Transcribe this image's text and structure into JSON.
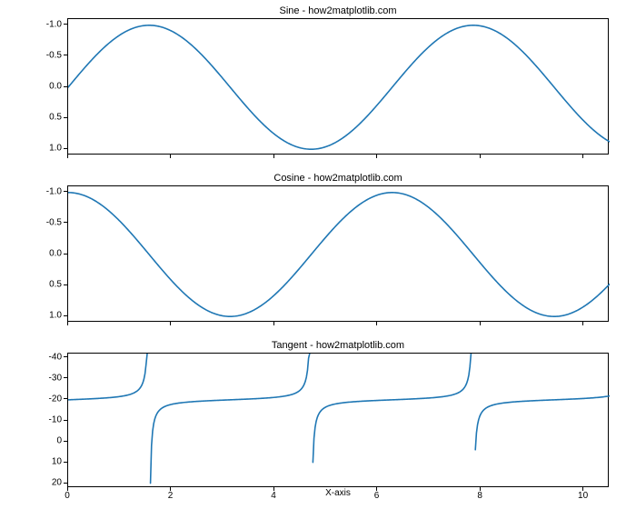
{
  "chart_data": [
    {
      "type": "line",
      "title": "Sine - how2matplotlib.com",
      "xlabel": "",
      "ylabel": "",
      "xlim": [
        0,
        10.5
      ],
      "ylim": [
        -1.1,
        1.1
      ],
      "xticks": [
        0,
        2,
        4,
        6,
        8,
        10
      ],
      "yticks": [
        -1.0,
        -0.5,
        0.0,
        0.5,
        1.0
      ],
      "function": "sin"
    },
    {
      "type": "line",
      "title": "Cosine - how2matplotlib.com",
      "xlabel": "",
      "ylabel": "",
      "xlim": [
        0,
        10.5
      ],
      "ylim": [
        -1.1,
        1.1
      ],
      "xticks": [
        0,
        2,
        4,
        6,
        8,
        10
      ],
      "yticks": [
        -1.0,
        -0.5,
        0.0,
        0.5,
        1.0
      ],
      "function": "cos"
    },
    {
      "type": "line",
      "title": "Tangent - how2matplotlib.com",
      "xlabel": "X-axis",
      "ylabel": "",
      "xlim": [
        0,
        10.5
      ],
      "ylim": [
        -42,
        22
      ],
      "xticks": [
        0,
        2,
        4,
        6,
        8,
        10
      ],
      "yticks": [
        -40,
        -30,
        -20,
        -10,
        0,
        10,
        20
      ],
      "function": "tan"
    }
  ],
  "titles": {
    "p0": "Sine - how2matplotlib.com",
    "p1": "Cosine - how2matplotlib.com",
    "p2": "Tangent - how2matplotlib.com"
  },
  "xlabel": "X-axis",
  "yt0": {
    "a": "1.0",
    "b": "0.5",
    "c": "0.0",
    "d": "-0.5",
    "e": "-1.0"
  },
  "yt1": {
    "a": "1.0",
    "b": "0.5",
    "c": "0.0",
    "d": "-0.5",
    "e": "-1.0"
  },
  "yt2": {
    "a": "20",
    "b": "10",
    "c": "0",
    "d": "-10",
    "e": "-20",
    "f": "-30",
    "g": "-40"
  },
  "xt": {
    "a": "0",
    "b": "2",
    "c": "4",
    "d": "6",
    "e": "8",
    "f": "10"
  }
}
